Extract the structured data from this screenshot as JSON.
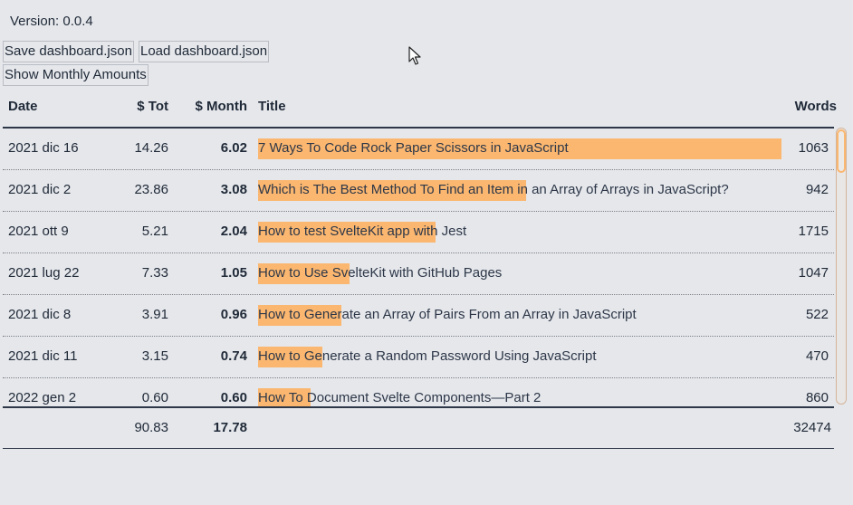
{
  "version_text": "Version: 0.0.4",
  "buttons": {
    "save": "Save dashboard.json",
    "load": "Load dashboard.json",
    "show_monthly": "Show Monthly Amounts"
  },
  "table": {
    "headers": {
      "date": "Date",
      "tot": "$ Tot",
      "month": "$ Month",
      "title": "Title",
      "words": "Words"
    },
    "rows": [
      {
        "date": "2021 dic 16",
        "tot": "14.26",
        "month": "6.02",
        "title": "7 Ways To Code Rock Paper Scissors in JavaScript",
        "words": "1063",
        "bar_fraction": 1.0
      },
      {
        "date": "2021 dic 2",
        "tot": "23.86",
        "month": "3.08",
        "title": "Which is The Best Method To Find an Item in an Array of Arrays in JavaScript?",
        "words": "942",
        "bar_fraction": 0.512
      },
      {
        "date": "2021 ott 9",
        "tot": "5.21",
        "month": "2.04",
        "title": "How to test SvelteKit app with Jest",
        "words": "1715",
        "bar_fraction": 0.339
      },
      {
        "date": "2021 lug 22",
        "tot": "7.33",
        "month": "1.05",
        "title": "How to Use SvelteKit with GitHub Pages",
        "words": "1047",
        "bar_fraction": 0.174
      },
      {
        "date": "2021 dic 8",
        "tot": "3.91",
        "month": "0.96",
        "title": "How to Generate an Array of Pairs From an Array in JavaScript",
        "words": "522",
        "bar_fraction": 0.159
      },
      {
        "date": "2021 dic 11",
        "tot": "3.15",
        "month": "0.74",
        "title": "How to Generate a Random Password Using JavaScript",
        "words": "470",
        "bar_fraction": 0.123
      },
      {
        "date": "2022 gen 2",
        "tot": "0.60",
        "month": "0.60",
        "title": "How To Document Svelte Components—Part 2",
        "words": "860",
        "bar_fraction": 0.1
      }
    ],
    "totals": {
      "tot": "90.83",
      "month": "17.78",
      "words": "32474"
    }
  },
  "colors": {
    "bar": "#fbb770",
    "background": "#e5e7eb"
  },
  "icons": {
    "cursor": "mouse-pointer-icon"
  }
}
